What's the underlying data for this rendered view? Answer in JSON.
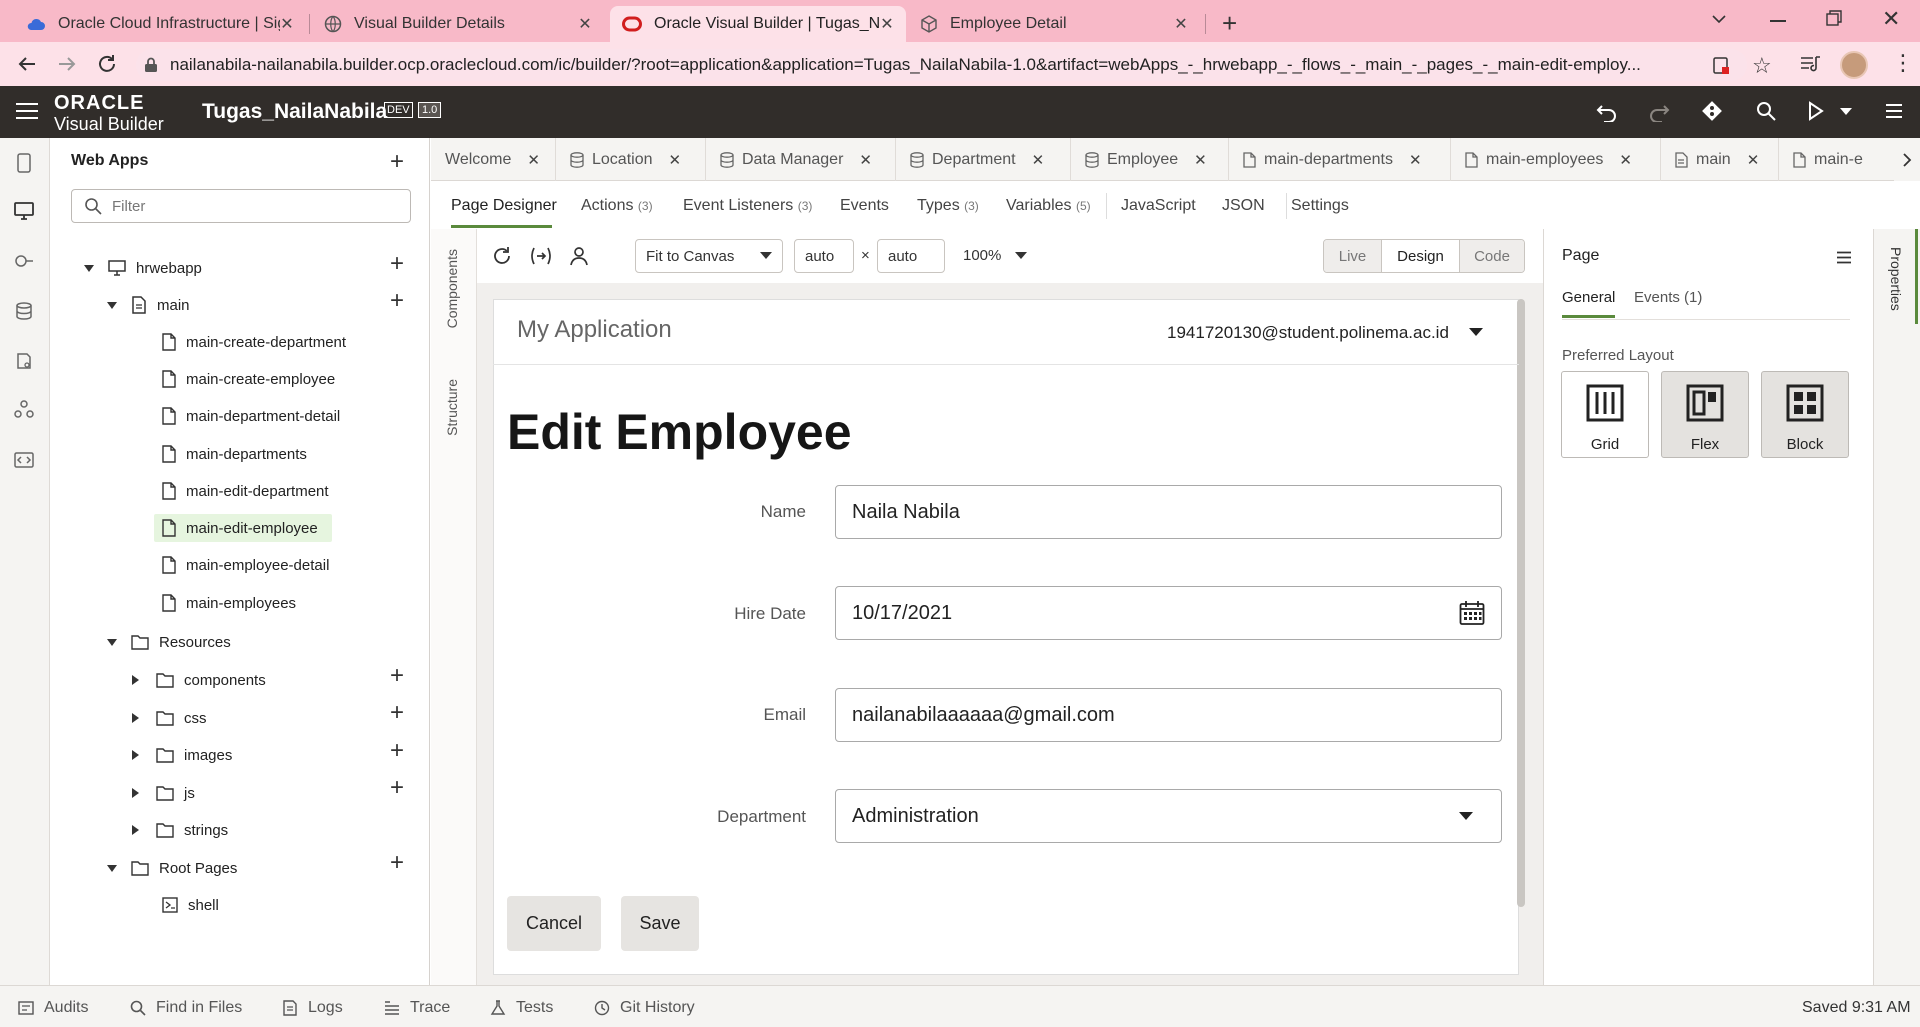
{
  "browser": {
    "tabs": [
      {
        "title": "Oracle Cloud Infrastructure | Sign",
        "icon": "cloud-icon"
      },
      {
        "title": "Visual Builder Details",
        "icon": "globe-icon"
      },
      {
        "title": "Oracle Visual Builder | Tugas_Nai",
        "icon": "oracle-icon"
      },
      {
        "title": "Employee Detail",
        "icon": "cube-icon"
      }
    ],
    "url": "nailanabila-nailanabila.builder.ocp.oraclecloud.com/ic/builder/?root=application&application=Tugas_NailaNabila-1.0&artifact=webApps_-_hrwebapp_-_flows_-_main_-_pages_-_main-edit-employ..."
  },
  "vb_header": {
    "logo_top": "ORACLE",
    "logo_bottom": "Visual Builder",
    "app_name": "Tugas_NailaNabila",
    "badge_dev": "DEV",
    "badge_version": "1.0"
  },
  "nav": {
    "section_title": "Web Apps",
    "filter_placeholder": "Filter",
    "webapp": "hrwebapp",
    "flow": "main",
    "pages": [
      "main-create-department",
      "main-create-employee",
      "main-department-detail",
      "main-departments",
      "main-edit-department",
      "main-edit-employee",
      "main-employee-detail",
      "main-employees"
    ],
    "resources_label": "Resources",
    "resources": [
      "components",
      "css",
      "images",
      "js",
      "strings"
    ],
    "root_pages_label": "Root Pages",
    "root_pages": [
      "shell"
    ]
  },
  "editor_tabs": [
    {
      "label": "Welcome",
      "icon": ""
    },
    {
      "label": "Location",
      "icon": "database-icon"
    },
    {
      "label": "Data Manager",
      "icon": "database-icon"
    },
    {
      "label": "Department",
      "icon": "database-icon"
    },
    {
      "label": "Employee",
      "icon": "database-icon"
    },
    {
      "label": "main-departments",
      "icon": "page-icon"
    },
    {
      "label": "main-employees",
      "icon": "page-icon"
    },
    {
      "label": "main",
      "icon": "flow-icon"
    },
    {
      "label": "main-e",
      "icon": "page-icon"
    }
  ],
  "sub_tabs": [
    {
      "label": "Page Designer",
      "count": ""
    },
    {
      "label": "Actions",
      "count": "(3)"
    },
    {
      "label": "Event Listeners",
      "count": "(3)"
    },
    {
      "label": "Events",
      "count": ""
    },
    {
      "label": "Types",
      "count": "(3)"
    },
    {
      "label": "Variables",
      "count": "(5)"
    },
    {
      "label": "JavaScript",
      "count": ""
    },
    {
      "label": "JSON",
      "count": ""
    },
    {
      "label": "Settings",
      "count": ""
    }
  ],
  "side_strip": {
    "components": "Components",
    "structure": "Structure"
  },
  "toolbar": {
    "fit": "Fit to Canvas",
    "width": "auto",
    "times": "×",
    "height": "auto",
    "zoom": "100%",
    "modes": [
      "Live",
      "Design",
      "Code"
    ]
  },
  "canvas": {
    "app_title": "My Application",
    "user": "1941720130@student.polinema.ac.id",
    "page_title": "Edit Employee",
    "fields": {
      "name_label": "Name",
      "name_value": "Naila Nabila",
      "hire_label": "Hire Date",
      "hire_value": "10/17/2021",
      "email_label": "Email",
      "email_value": "nailanabilaaaaaa@gmail.com",
      "dept_label": "Department",
      "dept_value": "Administration"
    },
    "cancel": "Cancel",
    "save": "Save"
  },
  "props": {
    "title": "Page",
    "tabs": [
      "General",
      "Events (1)"
    ],
    "layout_label": "Preferred Layout",
    "layouts": [
      "Grid",
      "Flex",
      "Block"
    ],
    "strip_label": "Properties"
  },
  "status": {
    "items": [
      "Audits",
      "Find in Files",
      "Logs",
      "Trace",
      "Tests",
      "Git History"
    ],
    "saved": "Saved 9:31 AM"
  },
  "colors": {
    "browser_chrome": "#f8b9c8",
    "vb_header": "#312d2a",
    "selected_page_bg": "#e6f5df",
    "active_tab_underline": "#5a8a3c"
  }
}
